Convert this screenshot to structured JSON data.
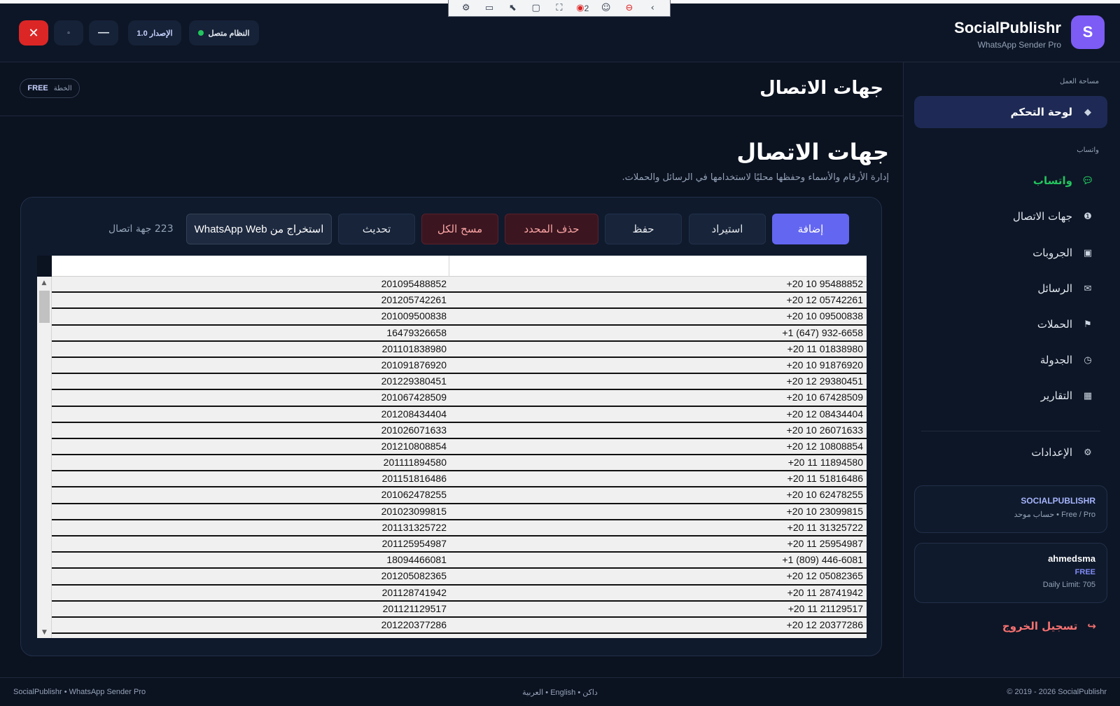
{
  "recorder": {
    "icons": [
      "settings-icon",
      "video-icon",
      "cursor-icon",
      "window-icon",
      "region-icon",
      "record-icon",
      "accessibility-icon",
      "stop-icon",
      "collapse-icon"
    ],
    "count": "2"
  },
  "header": {
    "brand_initial": "S",
    "brand_name": "SocialPublishr",
    "brand_sub": "WhatsApp Sender Pro",
    "version": "الإصدار 1.0",
    "status": "النظام متصل",
    "close_glyph": "✕",
    "max_glyph": "▫",
    "min_glyph": "—"
  },
  "sidebar": {
    "workspace_label": "مساحة العمل",
    "dashboard": "لوحة التحكم",
    "whatsapp_label": "واتساب",
    "items": [
      {
        "label": "واتساب",
        "icon": "chat-icon"
      },
      {
        "label": "جهات الاتصال",
        "icon": "info-icon"
      },
      {
        "label": "الجروبات",
        "icon": "group-icon"
      },
      {
        "label": "الرسائل",
        "icon": "mail-icon"
      },
      {
        "label": "الحملات",
        "icon": "flag-icon"
      },
      {
        "label": "الجدولة",
        "icon": "clock-icon"
      },
      {
        "label": "التقارير",
        "icon": "report-icon"
      }
    ],
    "settings": "الإعدادات",
    "account_card": {
      "title": "SOCIALPUBLISHR",
      "sub": "حساب موحد • Free / Pro"
    },
    "user_card": {
      "name": "ahmedsma",
      "plan": "FREE",
      "limit": "Daily Limit: 705"
    },
    "logout": "تسجيل الخروج"
  },
  "topbar": {
    "title": "جهات الاتصال",
    "plan_label": "الخطة",
    "plan_value": "FREE"
  },
  "main": {
    "title": "جهات الاتصال",
    "subtitle": "إدارة الأرقام والأسماء وحفظها محليًا لاستخدامها في الرسائل والحملات.",
    "buttons": {
      "add": "إضافة",
      "import": "استيراد",
      "save": "حفظ",
      "delete_selected": "حذف المحدد",
      "clear_all": "مسح الكل",
      "refresh": "تحديث",
      "extract": "استخراج من WhatsApp Web"
    },
    "count": "223 جهة اتصال",
    "rows": [
      [
        "201095488852",
        "+20 10 95488852"
      ],
      [
        "201205742261",
        "+20 12 05742261"
      ],
      [
        "201009500838",
        "+20 10 09500838"
      ],
      [
        "16479326658",
        "+1 (647) 932-6658"
      ],
      [
        "201101838980",
        "+20 11 01838980"
      ],
      [
        "201091876920",
        "+20 10 91876920"
      ],
      [
        "201229380451",
        "+20 12 29380451"
      ],
      [
        "201067428509",
        "+20 10 67428509"
      ],
      [
        "201208434404",
        "+20 12 08434404"
      ],
      [
        "201026071633",
        "+20 10 26071633"
      ],
      [
        "201210808854",
        "+20 12 10808854"
      ],
      [
        "201111894580",
        "+20 11 11894580"
      ],
      [
        "201151816486",
        "+20 11 51816486"
      ],
      [
        "201062478255",
        "+20 10 62478255"
      ],
      [
        "201023099815",
        "+20 10 23099815"
      ],
      [
        "201131325722",
        "+20 11 31325722"
      ],
      [
        "201125954987",
        "+20 11 25954987"
      ],
      [
        "18094466081",
        "+1 (809) 446-6081"
      ],
      [
        "201205082365",
        "+20 12 05082365"
      ],
      [
        "201128741942",
        "+20 11 28741942"
      ],
      [
        "201121129517",
        "+20 11 21129517"
      ],
      [
        "201220377286",
        "+20 12 20377286"
      ]
    ]
  },
  "footer": {
    "left": "SocialPublishr • WhatsApp Sender Pro",
    "center": "العربية • English • داكن",
    "right": "© 2019 - 2026 SocialPublishr"
  },
  "colors": {
    "accent": "#6366f1",
    "brand": "#7c5cf5",
    "success": "#22c55e",
    "danger": "#dc2626",
    "background": "#0b1220"
  }
}
